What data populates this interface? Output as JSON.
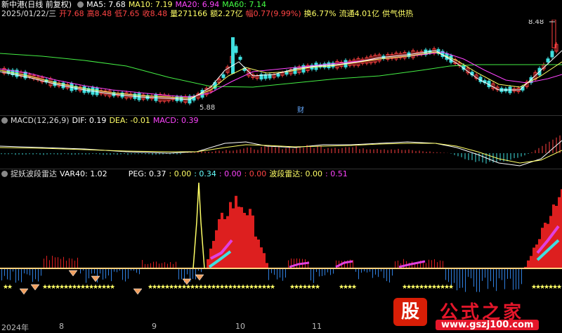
{
  "header": {
    "stock_name": "新中港(日线 前复权)",
    "ma5": "MA5: 7.68",
    "ma10": "MA10: 7.19",
    "ma20": "MA20: 6.94",
    "ma60": "MA60: 7.14",
    "colors": {
      "ma5": "#ffffff",
      "ma10": "#ffff66",
      "ma20": "#ff44ff",
      "ma60": "#44ff44"
    }
  },
  "quote": {
    "date": "2025/01/22/三",
    "open": "开7.68",
    "high": "高8.48",
    "low": "低7.65",
    "close": "收8.48",
    "volume": "量271166",
    "amount": "额2.27亿",
    "change": "幅0.77(9.99%)",
    "turnover": "换6.77%",
    "float": "流通4.01亿",
    "concept": "供气供热"
  },
  "price_panel": {
    "high_label": "8.48",
    "low_label": "5.88",
    "marker": "财"
  },
  "macd": {
    "title": "MACD(12,26,9)",
    "dif": "DIF: 0.19",
    "dea": "DEA: -0.01",
    "macd": "MACD: 0.39"
  },
  "radar": {
    "title": "捉妖波段雷达",
    "var40": "VAR40: 1.02",
    "peg": "PEG: 0.37",
    "v1": ": 0.00",
    "v2": ": 0.34",
    "v3": ": 0.00",
    "v4": ": 0.00",
    "wave": "波段雷达: 0.00",
    "v5": ": 0.51"
  },
  "xaxis": {
    "year": "2024年",
    "m8": "8",
    "m9": "9",
    "m10": "10",
    "m11": "11"
  },
  "logo": {
    "mark": "股",
    "cn": "公式之家",
    "url": "www.gszj100.com"
  }
}
